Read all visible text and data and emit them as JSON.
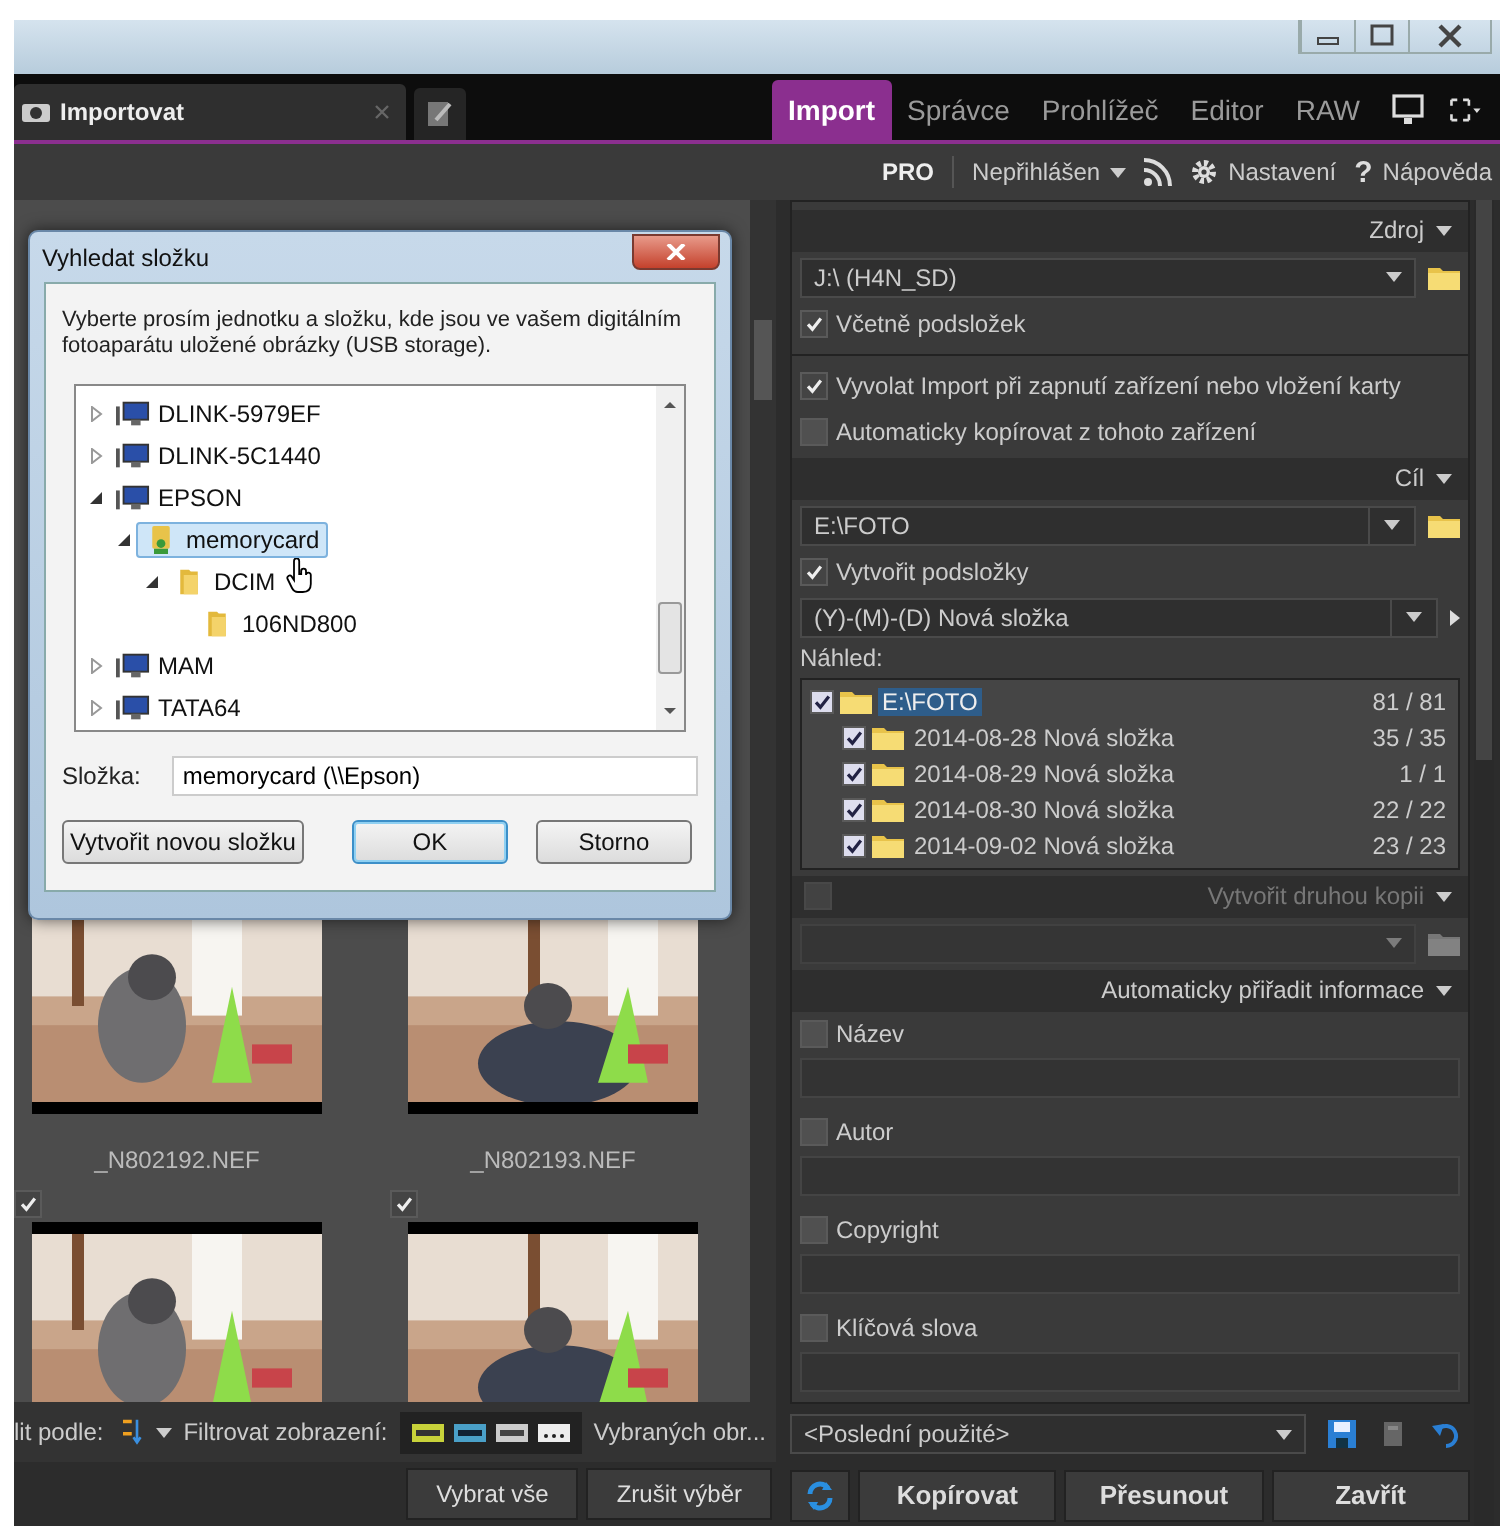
{
  "doc_tab": {
    "label": "Importovat"
  },
  "mode_tabs": [
    {
      "label": "Import",
      "selected": true
    },
    {
      "label": "Správce",
      "selected": false
    },
    {
      "label": "Prohlížeč",
      "selected": false
    },
    {
      "label": "Editor",
      "selected": false
    },
    {
      "label": "RAW",
      "selected": false
    }
  ],
  "toolbar": {
    "edition": "PRO",
    "account": "Nepřihlášen",
    "settings": "Nastavení",
    "help_glyph": "?",
    "help": "Nápověda"
  },
  "dialog": {
    "title": "Vyhledat složku",
    "message": "Vyberte prosím jednotku a složku, kde jsou ve vašem digitálním fotoaparátu uložené obrázky (USB storage).",
    "tree": [
      {
        "label": "DLINK-5979EF",
        "kind": "computer",
        "expanded": false,
        "selected": false
      },
      {
        "label": "DLINK-5C1440",
        "kind": "computer",
        "expanded": false,
        "selected": false
      },
      {
        "label": "EPSON",
        "kind": "computer",
        "expanded": true,
        "selected": false,
        "children": [
          {
            "label": "memorycard",
            "kind": "share",
            "expanded": true,
            "selected": true,
            "children": [
              {
                "label": "DCIM",
                "kind": "folder",
                "expanded": true,
                "selected": false,
                "children": [
                  {
                    "label": "106ND800",
                    "kind": "folder",
                    "selected": false
                  }
                ]
              }
            ]
          }
        ]
      },
      {
        "label": "MAM",
        "kind": "computer",
        "expanded": false,
        "selected": false
      },
      {
        "label": "TATA64",
        "kind": "computer",
        "expanded": false,
        "selected": false
      }
    ],
    "folder_label": "Složka:",
    "folder_value": "memorycard (\\\\Epson)",
    "buttons": [
      {
        "label": "Vytvořit novou složku",
        "default": false
      },
      {
        "label": "OK",
        "default": true
      },
      {
        "label": "Storno",
        "default": false
      }
    ]
  },
  "thumbnails": [
    {
      "kind": "picture",
      "filename": "_N802192.NEF"
    },
    {
      "kind": "picture",
      "filename": "_N802193.NEF"
    },
    {
      "kind": "picture",
      "checked": true
    },
    {
      "kind": "picture",
      "checked": true
    }
  ],
  "browser_bar": {
    "sort_label": "lit podle:",
    "filter_label": "Filtrovat zobrazení:",
    "selected_label": "Vybraných obr...",
    "buttons": [
      "Vybrat vše",
      "Zrušit výběr"
    ]
  },
  "source": {
    "header": "Zdroj",
    "path": "J:\\ (H4N_SD)",
    "include_subfolders": {
      "label": "Včetně podsložek",
      "checked": true
    }
  },
  "device_options": [
    {
      "label": "Vyvolat Import při zapnutí zařízení nebo vložení karty",
      "checked": true
    },
    {
      "label": "Automaticky kopírovat z tohoto zařízení",
      "checked": false
    }
  ],
  "target": {
    "header": "Cíl",
    "path": "E:\\FOTO",
    "create_subfolders": {
      "label": "Vytvořit podsložky",
      "checked": true
    },
    "pattern": "(Y)-(M)-(D) Nová složka",
    "preview_label": "Náhled:",
    "preview": [
      {
        "label": "E:\\FOTO",
        "count": "81 / 81",
        "checked": true,
        "selected": true,
        "children": [
          {
            "label": "2014-08-28 Nová složka",
            "count": "35 / 35",
            "checked": true,
            "selected": false
          },
          {
            "label": "2014-08-29 Nová složka",
            "count": "1 / 1",
            "checked": true,
            "selected": false
          },
          {
            "label": "2014-08-30 Nová složka",
            "count": "22 / 22",
            "checked": true,
            "selected": false
          },
          {
            "label": "2014-09-02 Nová složka",
            "count": "23 / 23",
            "checked": true,
            "selected": false
          }
        ]
      }
    ]
  },
  "second_copy": {
    "label": "Vytvořit druhou kopii",
    "checked": false,
    "disabled": true
  },
  "metadata": {
    "header": "Automaticky přiřadit informace",
    "fields": [
      {
        "label": "Název",
        "checked": false
      },
      {
        "label": "Autor",
        "checked": false
      },
      {
        "label": "Copyright",
        "checked": false
      },
      {
        "label": "Klíčová slova",
        "checked": false
      }
    ]
  },
  "preset": {
    "value": "<Poslední použité>"
  },
  "actions": [
    "Kopírovat",
    "Přesunout",
    "Zavřít"
  ]
}
